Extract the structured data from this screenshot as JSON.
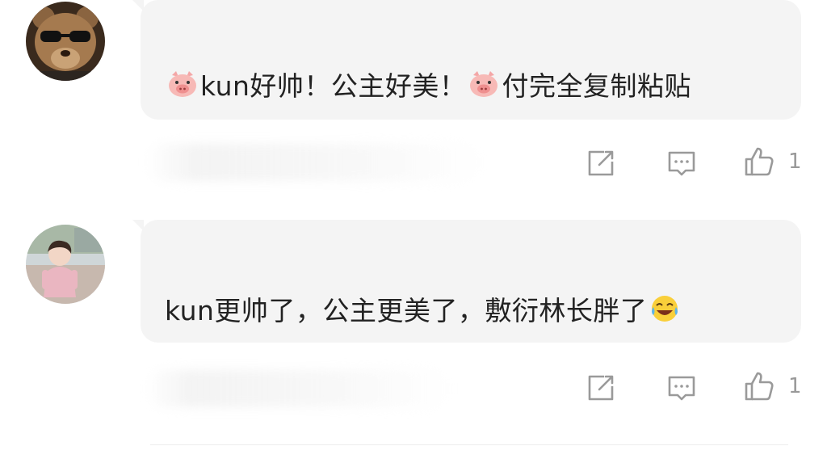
{
  "comments": [
    {
      "avatar": "teddy-bear-sunglasses-avatar",
      "segments": [
        {
          "type": "emoji",
          "icon": "pig-face-icon"
        },
        {
          "type": "text",
          "text": "kun好帅！公主好美！"
        },
        {
          "type": "emoji",
          "icon": "pig-face-icon"
        },
        {
          "type": "text",
          "text": "付完全复制粘贴"
        }
      ],
      "likes": "1"
    },
    {
      "avatar": "child-photo-avatar",
      "segments": [
        {
          "type": "text",
          "text": "kun更帅了，公主更美了，敷衍林长胖了"
        },
        {
          "type": "emoji",
          "icon": "laughing-crying-face-icon"
        }
      ],
      "likes": "1"
    }
  ],
  "colors": {
    "bubble": "#f4f4f4",
    "text": "#222222",
    "icon": "#9a9a9a"
  }
}
